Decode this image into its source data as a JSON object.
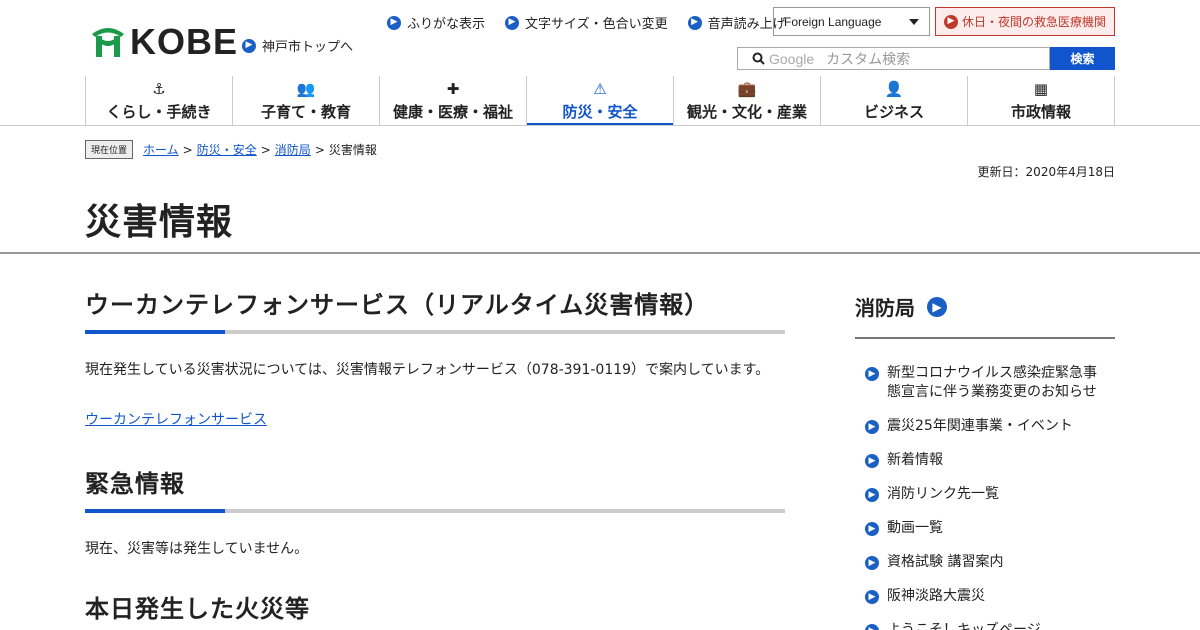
{
  "header": {
    "logo_text": "KOBE",
    "top_link": "神戸市トップへ",
    "utility": [
      "ふりがな表示",
      "文字サイズ・色合い変更",
      "音声読み上げ"
    ],
    "language_select": "Foreign Language",
    "emergency_link": "休日・夜間の救急医療機関",
    "search_brand": "Google",
    "search_placeholder": "カスタム検索",
    "search_button": "検索"
  },
  "nav": [
    {
      "label": "くらし・手続き",
      "icon": "anchor-icon",
      "glyph": "⚓"
    },
    {
      "label": "子育て・教育",
      "icon": "people-icon",
      "glyph": "👥"
    },
    {
      "label": "健康・医療・福祉",
      "icon": "hospital-icon",
      "glyph": "✚"
    },
    {
      "label": "防災・安全",
      "icon": "warning-icon",
      "glyph": "⚠"
    },
    {
      "label": "観光・文化・産業",
      "icon": "suitcase-icon",
      "glyph": "💼"
    },
    {
      "label": "ビジネス",
      "icon": "person-icon",
      "glyph": "👤"
    },
    {
      "label": "市政情報",
      "icon": "building-icon",
      "glyph": "▦"
    }
  ],
  "nav_active_index": 3,
  "breadcrumb": {
    "badge": "現在位置",
    "items": [
      "ホーム",
      "防災・安全",
      "消防局"
    ],
    "current": "災害情報",
    "separator": ">"
  },
  "updated": "更新日：2020年4月18日",
  "page_title": "災害情報",
  "main": {
    "section1_title": "ウーカンテレフォンサービス（リアルタイム災害情報）",
    "section1_text": "現在発生している災害状況については、災害情報テレフォンサービス（078-391-0119）で案内しています。",
    "section1_link": "ウーカンテレフォンサービス",
    "section2_title": "緊急情報",
    "section2_text": "現在、災害等は発生していません。",
    "section3_title": "本日発生した火災等"
  },
  "sidebar": {
    "title": "消防局",
    "items": [
      "新型コロナウイルス感染症緊急事態宣言に伴う業務変更のお知らせ",
      "震災25年関連事業・イベント",
      "新着情報",
      "消防リンク先一覧",
      "動画一覧",
      "資格試験 講習案内",
      "阪神淡路大震災",
      "ようこそ！キッズページ"
    ]
  },
  "colors": {
    "accent": "#1155cc",
    "logo_green": "#1a9a4a",
    "emergency_red": "#c0392b"
  }
}
